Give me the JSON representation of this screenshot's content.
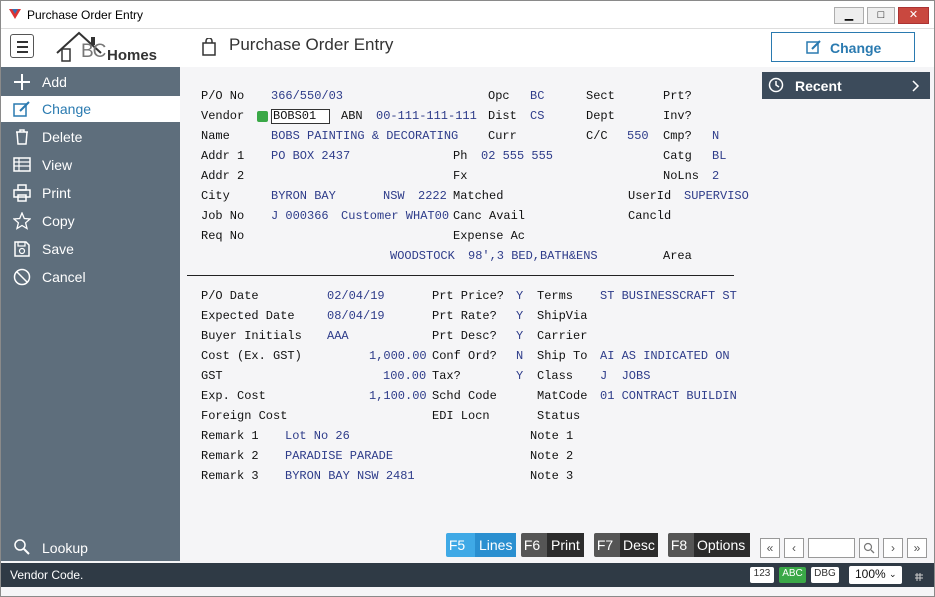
{
  "window": {
    "title": "Purchase Order Entry",
    "min": "▁",
    "max": "□",
    "close": "✕"
  },
  "header": {
    "brand_bc": "BC",
    "brand_homes": "Homes",
    "page_title": "Purchase Order Entry",
    "change_label": "Change"
  },
  "sidebar": {
    "items": [
      {
        "label": "Add",
        "icon": "plus-icon"
      },
      {
        "label": "Change",
        "icon": "edit-icon"
      },
      {
        "label": "Delete",
        "icon": "trash-icon"
      },
      {
        "label": "View",
        "icon": "table-icon"
      },
      {
        "label": "Print",
        "icon": "printer-icon"
      },
      {
        "label": "Copy",
        "icon": "star-icon"
      },
      {
        "label": "Save",
        "icon": "save-icon"
      },
      {
        "label": "Cancel",
        "icon": "cancel-icon"
      }
    ],
    "lookup": "Lookup"
  },
  "recent": {
    "label": "Recent"
  },
  "form": {
    "po_no_lbl": "P/O No",
    "po_no": "366/550/03",
    "opc_lbl": "Opc",
    "opc": "BC",
    "sect_lbl": "Sect",
    "prt_lbl": "Prt?",
    "vendor_lbl": "Vendor",
    "vendor": "BOBS01",
    "abn_lbl": "ABN",
    "abn": "00-111-111-111",
    "dist_lbl": "Dist",
    "dist": "CS",
    "dept_lbl": "Dept",
    "inv_lbl": "Inv?",
    "name_lbl": "Name",
    "name": "BOBS PAINTING & DECORATING",
    "curr_lbl": "Curr",
    "cc_lbl": "C/C",
    "cc": "550",
    "cmp_lbl": "Cmp?",
    "cmp": "N",
    "addr1_lbl": "Addr 1",
    "addr1": "PO BOX 2437",
    "ph_lbl": "Ph",
    "ph": "02 555 555",
    "catg_lbl": "Catg",
    "catg": "BL",
    "addr2_lbl": "Addr 2",
    "fx_lbl": "Fx",
    "nolns_lbl": "NoLns",
    "nolns": "2",
    "city_lbl": "City",
    "city": "BYRON BAY",
    "state": "NSW",
    "postcode": "2222",
    "matched_lbl": "Matched",
    "userid_lbl": "UserId",
    "userid": "SUPERVISO",
    "job_lbl": "Job No",
    "job": "J 000366",
    "job_desc": "Customer WHAT00",
    "canc_lbl": "Canc Avail",
    "cancld_lbl": "Cancld",
    "req_lbl": "Req No",
    "exp_ac_lbl": "Expense Ac",
    "job_addr": "WOODSTOCK",
    "job_detail": "98',3 BED,BATH&ENS",
    "area_lbl": "Area",
    "podate_lbl": "P/O Date",
    "podate": "02/04/19",
    "prtprice_lbl": "Prt Price?",
    "prtprice": "Y",
    "terms_lbl": "Terms",
    "terms": "ST BUSINESSCRAFT ST",
    "expdate_lbl": "Expected Date",
    "expdate": "08/04/19",
    "prtrate_lbl": "Prt Rate?",
    "prtrate": "Y",
    "shipvia_lbl": "ShipVia",
    "buyer_lbl": "Buyer Initials",
    "buyer": "AAA",
    "prtdesc_lbl": "Prt Desc?",
    "prtdesc": "Y",
    "carrier_lbl": "Carrier",
    "cost_lbl": "Cost (Ex. GST)",
    "cost": "1,000.00",
    "conford_lbl": "Conf Ord?",
    "conford": "N",
    "shipto_lbl": "Ship To",
    "shipto": "AI AS INDICATED ON",
    "gst_lbl": "GST",
    "gst": "100.00",
    "tax_lbl": "Tax?",
    "tax": "Y",
    "class_lbl": "Class",
    "class": "J  JOBS",
    "expcost_lbl": "Exp. Cost",
    "expcost": "1,100.00",
    "schd_lbl": "Schd Code",
    "matcode_lbl": "MatCode",
    "matcode": "01 CONTRACT BUILDIN",
    "fcost_lbl": "Foreign Cost",
    "edi_lbl": "EDI Locn",
    "status_lbl": "Status",
    "rem1_lbl": "Remark 1",
    "rem1": "Lot No 26",
    "note1_lbl": "Note 1",
    "rem2_lbl": "Remark 2",
    "rem2": "PARADISE PARADE",
    "note2_lbl": "Note 2",
    "rem3_lbl": "Remark 3",
    "rem3": "BYRON BAY NSW 2481",
    "note3_lbl": "Note 3"
  },
  "fkeys": [
    {
      "key": "F5",
      "label": "Lines"
    },
    {
      "key": "F6",
      "label": "Print"
    },
    {
      "key": "F7",
      "label": "Desc"
    },
    {
      "key": "F8",
      "label": "Options"
    }
  ],
  "status": {
    "message": "Vendor Code.",
    "chip1": "123",
    "chip2": "ABC",
    "chip3": "DBG",
    "zoom": "100%"
  },
  "colors": {
    "accent": "#2a7ab0",
    "sidebar": "#5e6e7c",
    "status_bar": "#2f3a45"
  }
}
